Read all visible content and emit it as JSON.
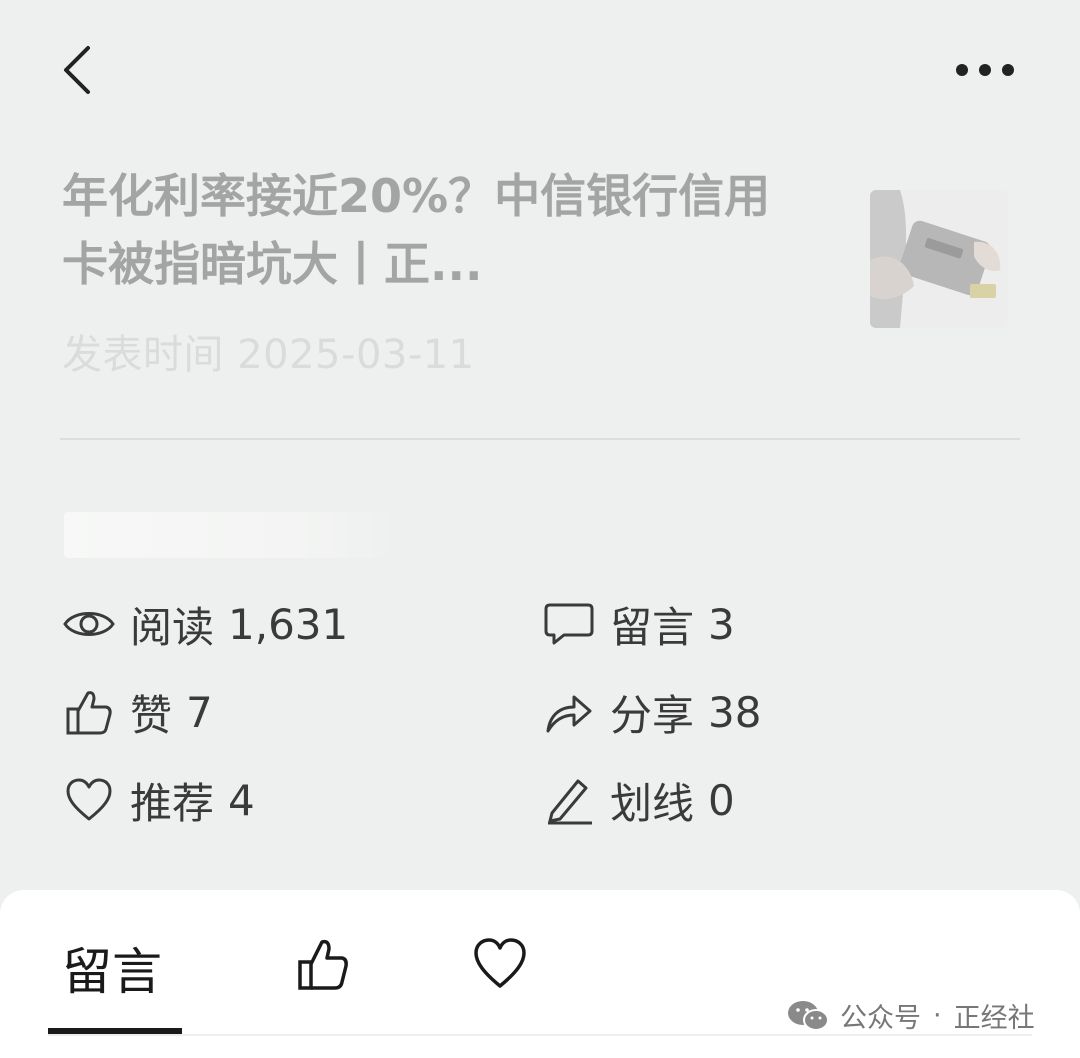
{
  "header": {
    "back_icon": "chevron-left-icon",
    "more_icon": "more-horizontal-icon"
  },
  "article": {
    "title": "年化利率接近20%？中信银行信用卡被指暗坑大丨正...",
    "published_label": "发表时间 2025-03-11",
    "thumbnail_icon": "card-payment-terminal-image"
  },
  "stats": {
    "reads": {
      "label": "阅读",
      "value": "1,631",
      "icon": "eye-icon"
    },
    "comments": {
      "label": "留言",
      "value": "3",
      "icon": "comment-bubble-icon"
    },
    "likes": {
      "label": "赞",
      "value": "7",
      "icon": "thumbs-up-icon"
    },
    "shares": {
      "label": "分享",
      "value": "38",
      "icon": "share-arrow-icon"
    },
    "recommends": {
      "label": "推荐",
      "value": "4",
      "icon": "heart-icon"
    },
    "underlines": {
      "label": "划线",
      "value": "0",
      "icon": "pencil-icon"
    }
  },
  "tabs": {
    "comments_label": "留言",
    "like_icon": "thumbs-up-icon",
    "recommend_icon": "heart-icon"
  },
  "watermark": {
    "source": "公众号",
    "separator": "·",
    "account": "正经社",
    "icon": "wechat-icon"
  },
  "colors": {
    "background": "#eef0ef",
    "title_gray": "#a3a5a4",
    "sheet": "#ffffff",
    "text": "#3a3a3a"
  }
}
